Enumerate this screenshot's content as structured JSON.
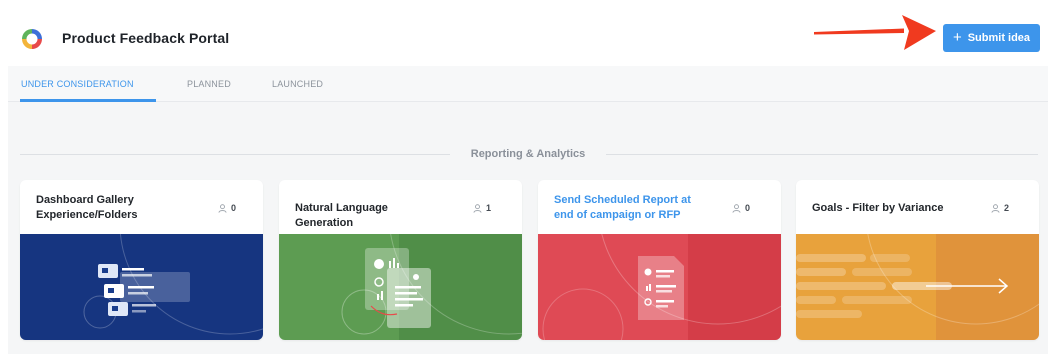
{
  "header": {
    "app_title": "Product Feedback Portal",
    "submit_label": "Submit idea",
    "submit_icon": "plus-icon",
    "accent_color": "#3d95eb",
    "arrow_color": "#f03a1f"
  },
  "tabs": [
    {
      "label": "UNDER CONSIDERATION",
      "active": true
    },
    {
      "label": "PLANNED",
      "active": false
    },
    {
      "label": "LAUNCHED",
      "active": false
    }
  ],
  "section": {
    "title": "Reporting & Analytics"
  },
  "cards": [
    {
      "title": "Dashboard Gallery Experience/Folders",
      "votes": "0",
      "title_color": "#22262b",
      "image": "folders-illustration",
      "bg": "#1a3d8c"
    },
    {
      "title": "Natural Language Generation",
      "votes": "1",
      "title_color": "#22262b",
      "image": "report-insight-illustration",
      "bg": "#5d9c52"
    },
    {
      "title": "Send Scheduled Report at end of campaign or RFP",
      "votes": "0",
      "title_color": "#3d95eb",
      "image": "report-document-illustration",
      "bg": "#df4a55"
    },
    {
      "title": "Goals - Filter by Variance",
      "votes": "2",
      "title_color": "#22262b",
      "image": "variance-arrow-illustration",
      "bg": "#e8a23c"
    }
  ]
}
